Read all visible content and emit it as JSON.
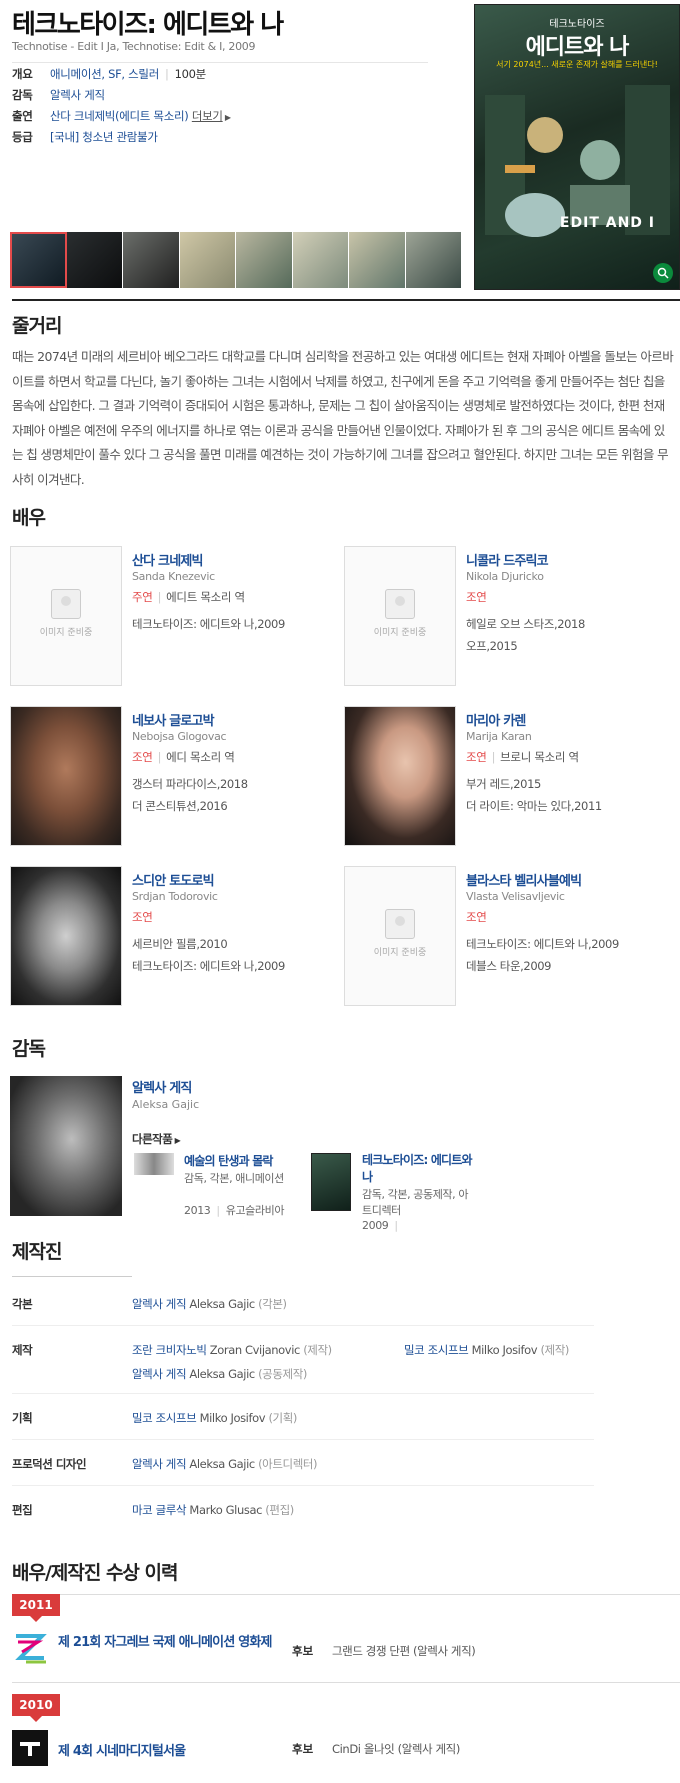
{
  "movie": {
    "title": "테크노타이즈: 에디트와 나",
    "subtitle": "Technotise - Edit I Ja, Technotise: Edit & I, 2009",
    "overview_label": "개요",
    "genre": "애니메이션, SF, 스릴러",
    "runtime": "100분",
    "director_label": "감독",
    "director": "알렉사 게직",
    "cast_label": "출연",
    "cast": "산다 크네제빅(에디트 목소리)",
    "cast_more": "더보기",
    "rating_label": "등급",
    "rating": "[국내] 청소년 관람불가"
  },
  "poster": {
    "top_text": "테크노타이즈",
    "title_text": "에디트와 나",
    "tagline": "서기 2074년... 새로운 존재가 살해를 드러낸다!",
    "logo": "EDIT AND I",
    "zoom_icon": "search-icon"
  },
  "synopsis": {
    "heading": "줄거리",
    "text": "때는 2074년 미래의 세르비아 베오그라드 대학교를 다니며 심리학을 전공하고 있는 여대생 에디트는 현재 자폐아 아벨을 돌보는 아르바이트를 하면서 학교를 다닌다, 놀기 좋아하는 그녀는 시험에서 낙제를 하였고, 친구에게 돈을 주고 기억력을 좋게 만들어주는 첨단 칩을 몸속에 삽입한다. 그 결과 기억력이 증대되어 시험은 통과하나, 문제는 그 칩이 살아움직이는 생명체로 발전하였다는 것이다, 한편 천재 자폐아 아벨은 예전에 우주의 에너지를 하나로 엮는 이론과 공식을 만들어낸 인물이었다. 자폐아가 된 후 그의 공식은 에디트 몸속에 있는 칩 생명체만이 풀수 있다 그 공식을 풀면 미래를 예견하는 것이 가능하기에 그녀를 잡으려고 혈안된다. 하지만 그녀는 모든 위험을 무사히 이겨낸다."
  },
  "actors": {
    "heading": "배우",
    "no_image": "이미지 준비중",
    "items": [
      {
        "name": "산다 크네제빅",
        "eng": "Sanda Knezevic",
        "type": "주연",
        "role": "에디트 목소리 역",
        "works": [
          "테크노타이즈: 에디트와 나,2009"
        ]
      },
      {
        "name": "니콜라 드주릭코",
        "eng": "Nikola Djuricko",
        "type": "조연",
        "role": "",
        "works": [
          "헤일로 오브 스타즈,2018",
          "오프,2015"
        ]
      },
      {
        "name": "네보사 글로고박",
        "eng": "Nebojsa Glogovac",
        "type": "조연",
        "role": "에디 목소리 역",
        "works": [
          "갱스터 파라다이스,2018",
          "더 콘스티튜션,2016"
        ]
      },
      {
        "name": "마리아 카렌",
        "eng": "Marija Karan",
        "type": "조연",
        "role": "브로니 목소리 역",
        "works": [
          "부거 레드,2015",
          "더 라이트: 악마는 있다,2011"
        ]
      },
      {
        "name": "스디안 토도로빅",
        "eng": "Srdjan Todorovic",
        "type": "조연",
        "role": "",
        "works": [
          "세르비안 필름,2010",
          "테크노타이즈: 에디트와 나,2009"
        ]
      },
      {
        "name": "블라스타 벨리사블예빅",
        "eng": "Vlasta Velisavljevic",
        "type": "조연",
        "role": "",
        "works": [
          "테크노타이즈: 에디트와 나,2009",
          "데블스 타운,2009"
        ]
      }
    ]
  },
  "director_section": {
    "heading": "감독",
    "name": "알렉사 게직",
    "eng": "Aleksa Gajic",
    "other_label": "다른작품",
    "works": [
      {
        "title": "예술의 탄생과 몰락",
        "roles": "감독, 각본, 애니메이션",
        "year": "2013",
        "country": "유고슬라비아"
      },
      {
        "title": "테크노타이즈: 에디트와 나",
        "roles": "감독, 각본, 공동제작, 아트디렉터",
        "year": "2009",
        "country": ""
      }
    ]
  },
  "crew": {
    "heading": "제작진",
    "rows": [
      {
        "label": "각본",
        "entries": [
          {
            "name": "알렉사 게직",
            "eng": "Aleksa Gajic",
            "role": "(각본)"
          }
        ]
      },
      {
        "label": "제작",
        "entries": [
          {
            "name": "조란 크비자노빅",
            "eng": "Zoran Cvijanovic",
            "role": "(제작)"
          },
          {
            "name": "밀코 조시프브",
            "eng": "Milko Josifov",
            "role": "(제작)"
          },
          {
            "name": "알렉사 게직",
            "eng": "Aleksa Gajic",
            "role": "(공동제작)"
          }
        ]
      },
      {
        "label": "기획",
        "entries": [
          {
            "name": "밀코 조시프브",
            "eng": "Milko Josifov",
            "role": "(기획)"
          }
        ]
      },
      {
        "label": "프로덕션 디자인",
        "entries": [
          {
            "name": "알렉사 게직",
            "eng": "Aleksa Gajic",
            "role": "(아트디렉터)"
          }
        ]
      },
      {
        "label": "편집",
        "entries": [
          {
            "name": "마코 글루삭",
            "eng": "Marko Glusac",
            "role": "(편집)"
          }
        ]
      }
    ]
  },
  "awards": {
    "heading": "배우/제작진 수상 이력",
    "items": [
      {
        "year": "2011",
        "festival": "제 21회 자그레브 국제 애니메이션 영화제",
        "status": "후보",
        "award": "그랜드 경쟁 단편 (알렉사 게직)"
      },
      {
        "year": "2010",
        "festival": "제 4회 시네마디지털서울",
        "status": "후보",
        "award": "CinDi 올나잇 (알렉사 게직)"
      }
    ]
  }
}
